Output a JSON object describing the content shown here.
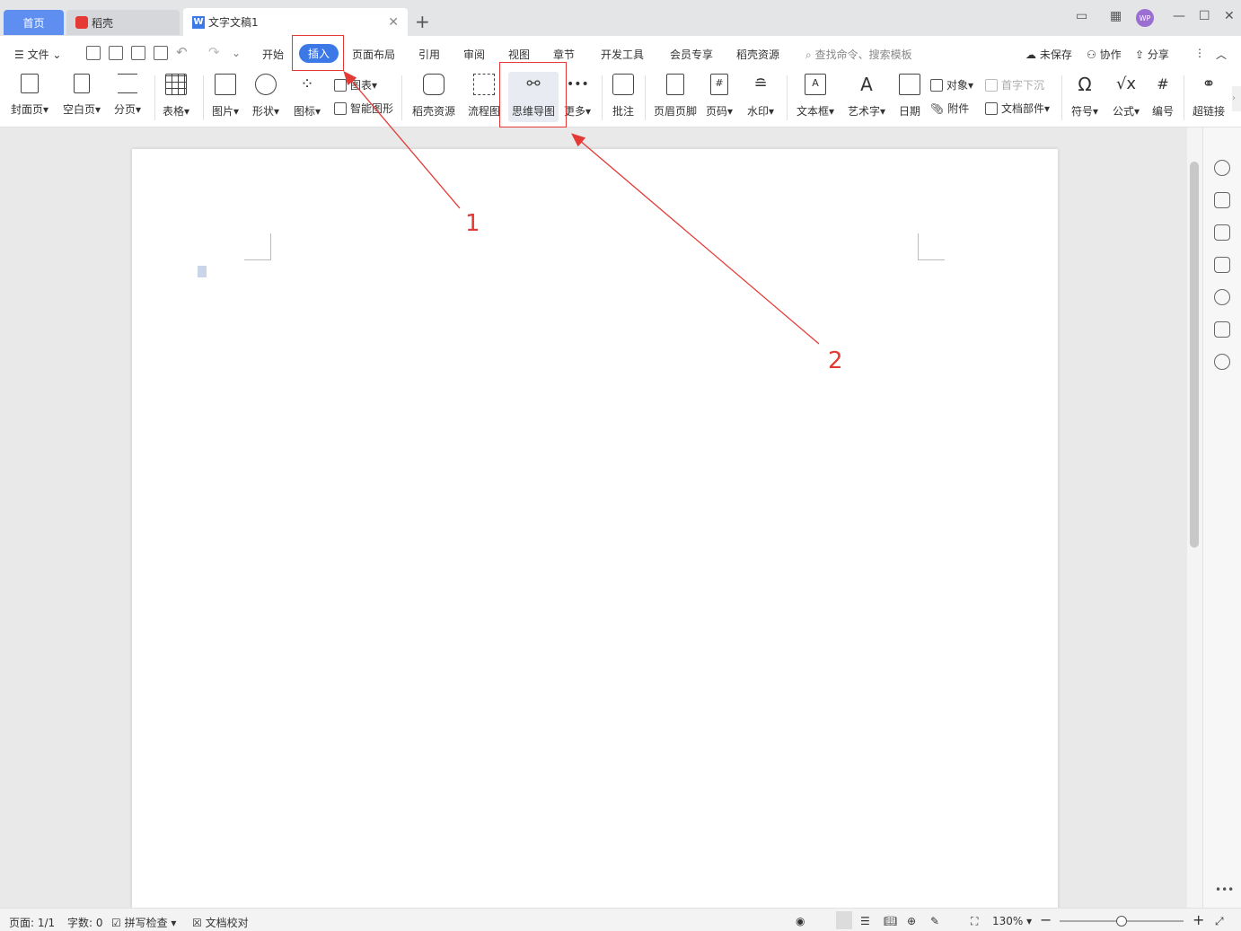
{
  "tabs": {
    "home": "首页",
    "daoke": "稻壳",
    "doc": "文字文稿1"
  },
  "menu": {
    "file": "文件",
    "items": [
      "开始",
      "插入",
      "页面布局",
      "引用",
      "审阅",
      "视图",
      "章节",
      "开发工具",
      "会员专享",
      "稻壳资源"
    ],
    "active": "插入",
    "search_placeholder": "查找命令、搜索模板",
    "unsaved": "未保存",
    "collab": "协作",
    "share": "分享"
  },
  "ribbon": {
    "cover": "封面页",
    "blank": "空白页",
    "pagebreak": "分页",
    "table": "表格",
    "picture": "图片",
    "shape": "形状",
    "icon": "图标",
    "chart": "图表",
    "smartart": "智能图形",
    "daoke_res": "稻壳资源",
    "flowchart": "流程图",
    "mindmap": "思维导图",
    "more": "更多",
    "comment": "批注",
    "header_footer": "页眉页脚",
    "page_num": "页码",
    "watermark": "水印",
    "textbox": "文本框",
    "wordart": "艺术字",
    "date": "日期",
    "object": "对象",
    "dropcap": "首字下沉",
    "attachment": "附件",
    "doc_parts": "文档部件",
    "symbol": "符号",
    "formula": "公式",
    "numbering": "编号",
    "hyperlink": "超链接"
  },
  "status": {
    "page": "页面: 1/1",
    "words": "字数: 0",
    "spellcheck": "拼写检查",
    "proofread": "文档校对",
    "zoom": "130%",
    "zoom_level": 0.5
  },
  "annotations": {
    "n1": "1",
    "n2": "2"
  },
  "colors": {
    "accent": "#3c78e6",
    "annotation": "#e53935"
  }
}
